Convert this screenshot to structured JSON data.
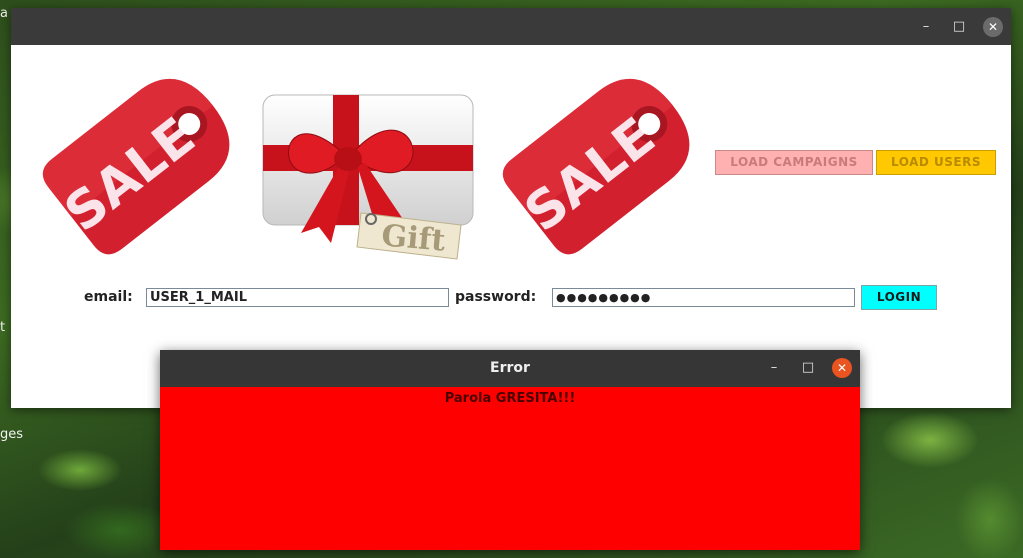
{
  "desktop": {
    "fragments": [
      "a",
      "t",
      "ges"
    ]
  },
  "main_window": {
    "title": "",
    "controls": {
      "minimize": "–",
      "maximize": "□",
      "close": "✕"
    },
    "images": {
      "sale_left": "SALE",
      "gift": "Gift",
      "sale_right": "SALE"
    },
    "buttons": {
      "load_campaigns": "LOAD CAMPAIGNS",
      "load_users": "LOAD USERS",
      "login": "LOGIN"
    },
    "form": {
      "email_label": "email:",
      "email_value": "USER_1_MAIL",
      "password_label": "password:",
      "password_value": "●●●●●●●●●"
    },
    "colors": {
      "load_campaigns_bg": "#ffb0b0",
      "load_users_bg": "#ffc800",
      "login_bg": "#00ffff",
      "sale_tag": "#d3202f"
    }
  },
  "error_dialog": {
    "title": "Error",
    "message": "Parola GRESITA!!!",
    "controls": {
      "minimize": "–",
      "maximize": "□",
      "close": "✕"
    },
    "background": "#ff0000"
  }
}
